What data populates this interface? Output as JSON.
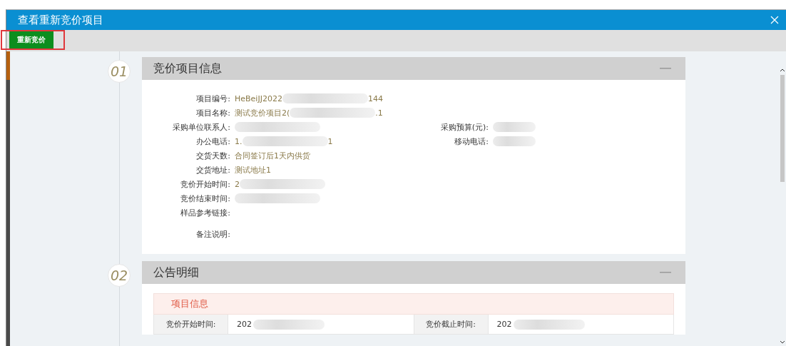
{
  "window": {
    "title": "查看重新竞价项目"
  },
  "toolbar": {
    "button": "重新竞价",
    "highlighted": true
  },
  "sections": [
    {
      "number": "01",
      "title": "竞价项目信息",
      "kind": "info",
      "rows": [
        {
          "label": "项目编号:",
          "value": "HeBeiJJ2022",
          "value_after": "144",
          "redacted": true
        },
        {
          "label": "项目名称:",
          "value": "测试竞价项目2(",
          "value_after": ".1",
          "redacted": true
        },
        {
          "label": "采购单位联系人:",
          "redacted": true,
          "right": {
            "label": "采购预算(元):",
            "redacted": true
          }
        },
        {
          "label": "办公电话:",
          "value": "1.",
          "value_after": "1",
          "redacted": true,
          "right": {
            "label": "移动电话:",
            "redacted": true
          }
        },
        {
          "label": "交货天数:",
          "value": "合同签订后1天内供货",
          "redacted": false
        },
        {
          "label": "交货地址:",
          "value": "测试地址1",
          "redacted": false
        },
        {
          "label": "竞价开始时间:",
          "value": "2",
          "redacted": true
        },
        {
          "label": "竞价结束时间:",
          "redacted": true
        },
        {
          "label": "样品参考链接:",
          "redacted": false
        },
        {
          "label": "备注说明:",
          "redacted": false
        }
      ]
    },
    {
      "number": "02",
      "title": "公告明细",
      "kind": "table",
      "subheading": "项目信息",
      "cells": [
        {
          "label": "竞价开始时间:",
          "value": "202",
          "redacted": true
        },
        {
          "label": "竞价截止时间:",
          "value": "202",
          "redacted": true
        }
      ]
    }
  ]
}
